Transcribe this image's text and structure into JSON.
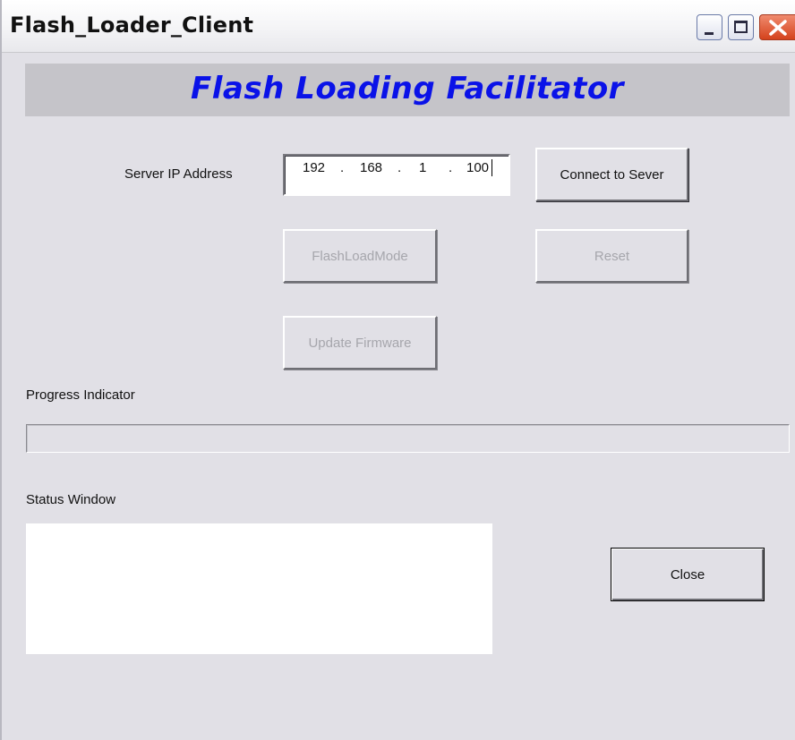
{
  "window": {
    "title": "Flash_Loader_Client"
  },
  "banner": {
    "title": "Flash Loading Facilitator",
    "color": "#0a12e8"
  },
  "server_ip": {
    "label": "Server IP Address",
    "octets": [
      "192",
      "168",
      "1",
      "100"
    ],
    "separator": "."
  },
  "buttons": {
    "connect": "Connect to Sever",
    "flash_load_mode": "FlashLoadMode",
    "reset": "Reset",
    "update_firmware": "Update Firmware",
    "close": "Close"
  },
  "progress": {
    "label": "Progress Indicator",
    "value": 0
  },
  "status": {
    "label": "Status Window",
    "text": ""
  },
  "titlebar_icons": [
    "minimize-icon",
    "maximize-icon",
    "close-icon"
  ]
}
